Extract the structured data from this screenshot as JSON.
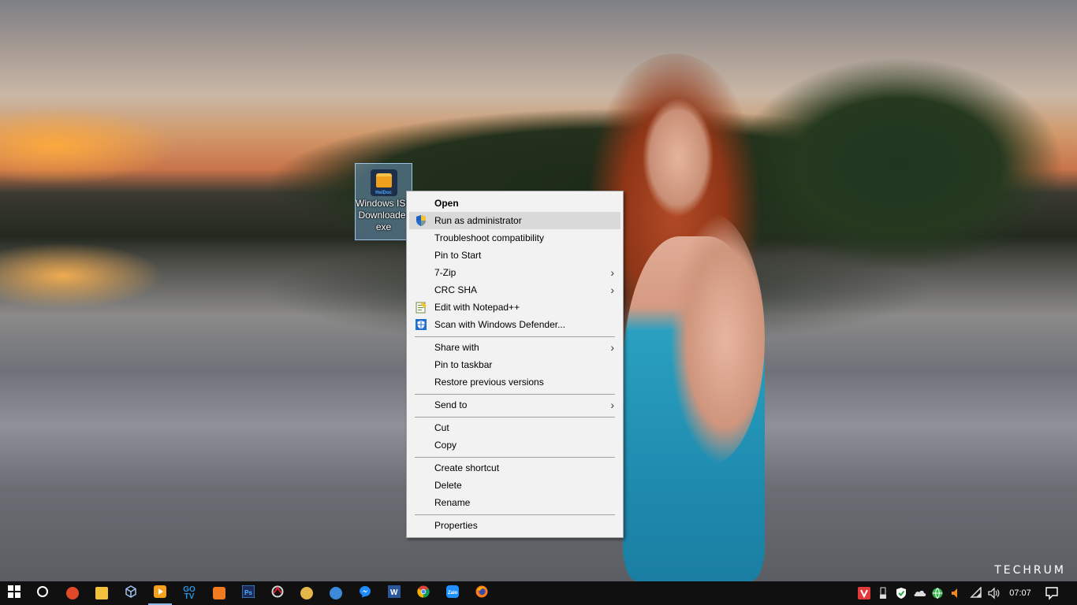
{
  "desktop_icon": {
    "label_line1": "Windows ISO",
    "label_line2": "Downloader",
    "label_line3": "exe",
    "brand": "HeiDoc"
  },
  "context_menu": {
    "items": [
      {
        "label": "Open",
        "bold": true
      },
      {
        "label": "Run as administrator",
        "icon": "uac-shield-icon",
        "highlighted": true
      },
      {
        "label": "Troubleshoot compatibility"
      },
      {
        "label": "Pin to Start"
      },
      {
        "label": "7-Zip",
        "submenu": true
      },
      {
        "label": "CRC SHA",
        "submenu": true
      },
      {
        "label": "Edit with Notepad++",
        "icon": "notepad-plus-plus-icon"
      },
      {
        "label": "Scan with Windows Defender...",
        "icon": "windows-defender-icon"
      },
      {
        "label": "Share with",
        "submenu": true
      },
      {
        "label": "Pin to taskbar"
      },
      {
        "label": "Restore previous versions"
      },
      {
        "label": "Send to",
        "submenu": true
      },
      {
        "label": "Cut"
      },
      {
        "label": "Copy"
      },
      {
        "label": "Create shortcut"
      },
      {
        "label": "Delete"
      },
      {
        "label": "Rename"
      },
      {
        "label": "Properties"
      }
    ]
  },
  "watermark": "TECHRUM",
  "taskbar": {
    "apps": [
      {
        "name": "start-button",
        "icon": "windows-logo-icon"
      },
      {
        "name": "cortana-button",
        "icon": "cortana-circle-icon"
      },
      {
        "name": "taskbar-app-1",
        "icon": "app-red-swirl-icon",
        "color": "#e04a2a"
      },
      {
        "name": "taskbar-app-file-explorer",
        "icon": "folder-icon",
        "color": "#f3c23a"
      },
      {
        "name": "taskbar-app-virtualbox",
        "icon": "cube-icon",
        "color": "#7fa7d8"
      },
      {
        "name": "taskbar-app-media-player",
        "icon": "play-icon",
        "color": "#f6a11b",
        "active": true
      },
      {
        "name": "taskbar-app-gotv",
        "icon": "gotv-icon",
        "color": "#2a92e0"
      },
      {
        "name": "taskbar-app-xampp",
        "icon": "xampp-icon",
        "color": "#f07a20"
      },
      {
        "name": "taskbar-app-photoshop",
        "icon": "photoshop-icon",
        "color": "#1b2a5a"
      },
      {
        "name": "taskbar-app-coccoc",
        "icon": "browser-icon",
        "color": "#c33"
      },
      {
        "name": "taskbar-app-paint",
        "icon": "paint-palette-icon",
        "color": "#e5b74a"
      },
      {
        "name": "taskbar-app-9",
        "icon": "app-blue-icon",
        "color": "#3b8ad9"
      },
      {
        "name": "taskbar-app-messenger",
        "icon": "messenger-icon",
        "color": "#1e8bff"
      },
      {
        "name": "taskbar-app-word",
        "icon": "word-icon",
        "color": "#2b579a"
      },
      {
        "name": "taskbar-app-chrome",
        "icon": "chrome-icon",
        "color": "#4caf50"
      },
      {
        "name": "taskbar-app-zalo",
        "icon": "zalo-icon",
        "color": "#1e90ff"
      },
      {
        "name": "taskbar-app-firefox",
        "icon": "firefox-icon",
        "color": "#ff7a1a"
      }
    ],
    "tray": [
      {
        "name": "tray-vivaldi-icon",
        "color": "#e23a3a"
      },
      {
        "name": "tray-usb-icon",
        "color": "#dddddd"
      },
      {
        "name": "tray-security-shield-icon",
        "color": "#2aa84a"
      },
      {
        "name": "tray-onedrive-icon",
        "color": "#dddddd"
      },
      {
        "name": "tray-network-globe-icon",
        "color": "#35b24a"
      },
      {
        "name": "tray-volume-mute-icon",
        "color": "#f08a20"
      },
      {
        "name": "tray-wifi-icon",
        "color": "#dddddd"
      },
      {
        "name": "tray-speaker-icon",
        "color": "#dddddd"
      }
    ],
    "clock": "07:07",
    "notification_icon": "action-center-icon"
  }
}
